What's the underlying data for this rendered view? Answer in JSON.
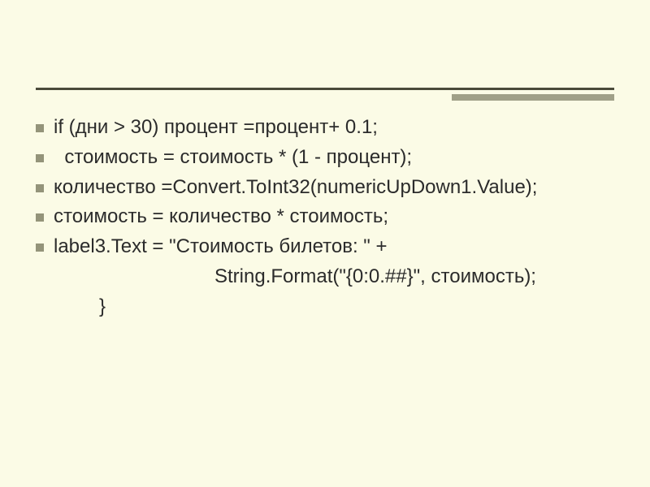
{
  "code": {
    "l1": "if (дни > 30) процент =процент+ 0.1;",
    "l2": "  стоимость = стоимость * (1 - процент);",
    "l3": "количество =Convert.ToInt32(numericUpDown1.Value);",
    "l4": "стоимость = количество * стоимость;",
    "l5": "label3.Text = \"Стоимость билетов: \" +",
    "l6": "String.Format(\"{0:0.##}\", стоимость);",
    "l7": "}"
  }
}
